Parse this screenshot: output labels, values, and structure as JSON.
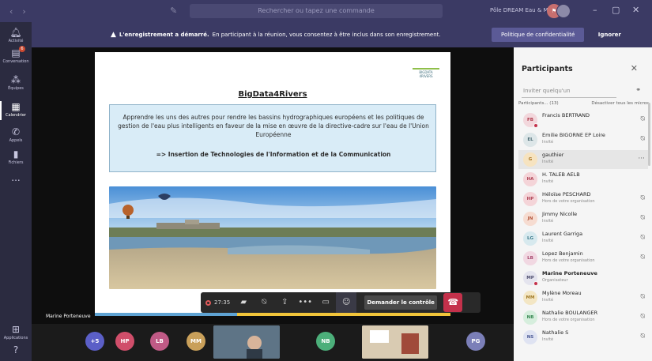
{
  "titlebar": {
    "search_placeholder": "Rechercher ou tapez une commande",
    "org": "Pôle DREAM Eau & Milieux",
    "user_initials": "FB"
  },
  "rail": {
    "items": [
      {
        "label": "Activité",
        "icon": "bell-icon"
      },
      {
        "label": "Conversation",
        "icon": "chat-icon",
        "badge": "6"
      },
      {
        "label": "Équipes",
        "icon": "teams-icon"
      },
      {
        "label": "Calendrier",
        "icon": "calendar-icon"
      },
      {
        "label": "Appels",
        "icon": "phone-icon"
      },
      {
        "label": "Fichiers",
        "icon": "file-icon"
      },
      {
        "label": "...",
        "icon": "more-icon"
      }
    ],
    "apps_label": "Applications"
  },
  "banner": {
    "bold": "L'enregistrement a démarré.",
    "text": "En participant à la réunion, vous consentez à être inclus dans son enregistrement.",
    "privacy_label": "Politique de confidentialité",
    "ignore_label": "Ignorer"
  },
  "slide": {
    "logo": "BIGDATA 4RIVERS",
    "title": "BigData4Rivers",
    "body": "Apprendre les uns des autres pour rendre les bassins hydrographiques européens et les politiques de gestion de l'eau plus intelligents en faveur de la mise en œuvre de la directive-cadre sur l'eau de l'Union Européenne",
    "sub": "=> Insertion de Technologies de l'Information et de la Communication"
  },
  "stage": {
    "speaker_name": "Marine Porteneuve"
  },
  "controls": {
    "timer": "27:35",
    "request_label": "Demander le contrôle"
  },
  "strip": {
    "chips": [
      {
        "label": "+5",
        "color": "#5b5fc7"
      },
      {
        "label": "HP",
        "color": "#d04e6a"
      },
      {
        "label": "LB",
        "color": "#c05a86"
      },
      {
        "label": "MM",
        "color": "#c9a05a"
      },
      {
        "label": "NB",
        "color": "#4caf7a"
      },
      {
        "label": "PG",
        "color": "#7b7fb8"
      }
    ]
  },
  "panel": {
    "title": "Participants",
    "invite_placeholder": "Inviter quelqu'un",
    "list_label": "Participants... (13)",
    "mute_all": "Désactiver tous les micros",
    "participants": [
      {
        "initials": "FB",
        "name": "Francis BERTRAND",
        "role": "",
        "color": "#f2d7dc",
        "text": "#b03a4c",
        "dot": "#c4314b"
      },
      {
        "initials": "EL",
        "name": "Emilie BIGORNE EP Loire",
        "role": "Invité",
        "color": "#dde6e8",
        "text": "#4b6b74"
      },
      {
        "initials": "G",
        "name": "gauthier",
        "role": "Invité",
        "color": "#f6e3c0",
        "text": "#a8731f"
      },
      {
        "initials": "HA",
        "name": "H. TALEB AELB",
        "role": "Invité",
        "color": "#f4d4d8",
        "text": "#b04456"
      },
      {
        "initials": "HP",
        "name": "Héloïse PESCHARD",
        "role": "Hors de votre organisation",
        "color": "#f4d4d8",
        "text": "#b04456"
      },
      {
        "initials": "JN",
        "name": "Jimmy Nicolle",
        "role": "Invité",
        "color": "#f6dcd1",
        "text": "#b4553a"
      },
      {
        "initials": "LG",
        "name": "Laurent Garriga",
        "role": "Invité",
        "color": "#d7e9ee",
        "text": "#3d7b8b"
      },
      {
        "initials": "LB",
        "name": "Lopez Benjamin",
        "role": "Hors de votre organisation",
        "color": "#f1d8e2",
        "text": "#a6476d"
      },
      {
        "initials": "MP",
        "name": "Marine Porteneuve",
        "role": "Organisateur",
        "color": "#e4e4ee",
        "text": "#505070",
        "dot": "#c4314b",
        "bold": true
      },
      {
        "initials": "MM",
        "name": "Mylène Moreau",
        "role": "Invité",
        "color": "#f3e6c4",
        "text": "#a17a27"
      },
      {
        "initials": "NB",
        "name": "Nathalie BOULANGER",
        "role": "Hors de votre organisation",
        "color": "#d6eedd",
        "text": "#3a8a54"
      },
      {
        "initials": "NS",
        "name": "Nathalie S",
        "role": "Invité",
        "color": "#dfe3f2",
        "text": "#4b5a95"
      }
    ]
  }
}
